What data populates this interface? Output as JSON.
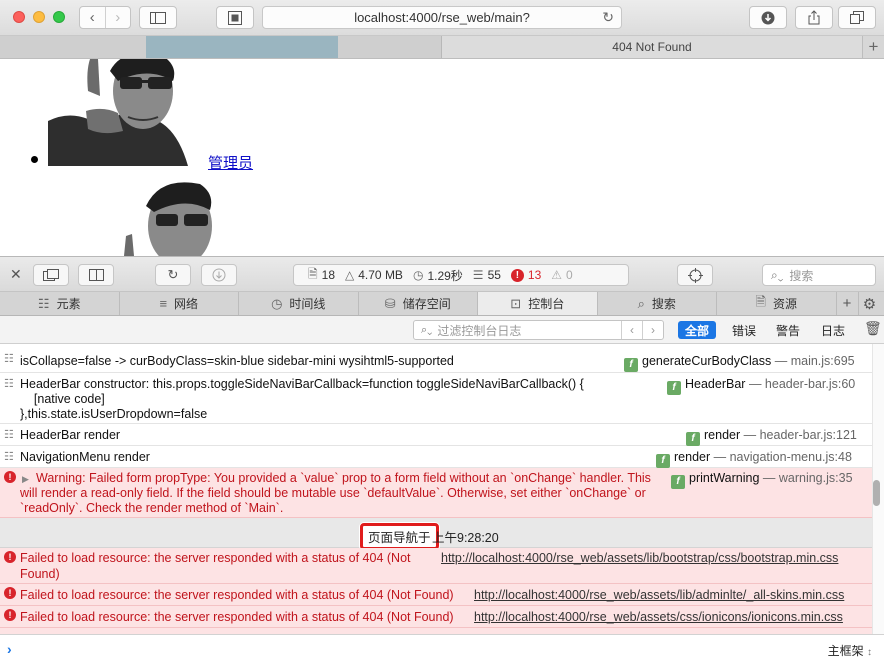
{
  "browser": {
    "url": "localhost:4000/rse_web/main?",
    "tabs": [
      {
        "title": ""
      },
      {
        "title": "404 Not Found"
      }
    ]
  },
  "page": {
    "user_link": "管理员"
  },
  "inspector": {
    "stats": {
      "resources": "18",
      "size": "4.70 MB",
      "time": "1.29秒",
      "logs": "55",
      "errors": "13",
      "warnings": "0"
    },
    "search_placeholder": "搜索",
    "tabs": [
      "元素",
      "网络",
      "时间线",
      "储存空间",
      "控制台",
      "搜索",
      "资源"
    ],
    "active_tab": "控制台",
    "filter_placeholder": "过滤控制台日志",
    "filters": [
      "全部",
      "错误",
      "警告",
      "日志"
    ],
    "frame_selector": "主框架"
  },
  "console": {
    "logs": [
      {
        "level": "log",
        "message": "isCollapse=false -> curBodyClass=skin-blue sidebar-mini wysihtml5-supported",
        "func": "generateCurBodyClass",
        "file": "— main.js:695"
      },
      {
        "level": "log",
        "message_lines": [
          "HeaderBar constructor: this.props.toggleSideNaviBarCallback=function toggleSideNaviBarCallback() {",
          "    [native code]",
          "},this.state.isUserDropdown=false"
        ],
        "func": "HeaderBar",
        "file": "— header-bar.js:60"
      },
      {
        "level": "log",
        "message": "HeaderBar render",
        "func": "render",
        "file": "— header-bar.js:121"
      },
      {
        "level": "log",
        "message": "NavigationMenu render",
        "func": "render",
        "file": "— navigation-menu.js:48"
      },
      {
        "level": "error",
        "message_lines": [
          "Warning: Failed form propType: You provided a `value` prop to a form field without an `onChange` handler. This",
          "will render a read-only field. If the field should be mutable use `defaultValue`. Otherwise, set either `onChange` or",
          "`readOnly`. Check the render method of `Main`."
        ],
        "func": "printWarning",
        "file": "— warning.js:35"
      }
    ],
    "navigation_label": "页面导航于",
    "navigation_time": "上午9:28:20",
    "errors": [
      {
        "message_lines": [
          "Failed to load resource: the server responded with a status of 404 (Not",
          "Found)"
        ],
        "url": "http://localhost:4000/rse_web/assets/lib/bootstrap/css/bootstrap.min.css"
      },
      {
        "message": "Failed to load resource: the server responded with a status of 404 (Not Found)",
        "url": "http://localhost:4000/rse_web/assets/lib/adminlte/_all-skins.min.css"
      },
      {
        "message": "Failed to load resource: the server responded with a status of 404 (Not Found)",
        "url": "http://localhost:4000/rse_web/assets/css/ionicons/ionicons.min.css"
      }
    ]
  }
}
